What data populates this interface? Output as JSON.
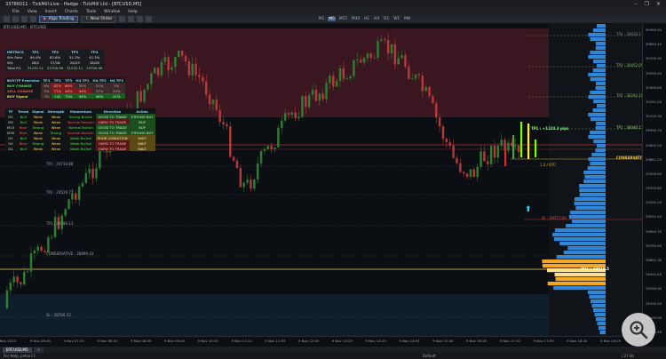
{
  "window": {
    "title": "33786011 - TickMill-Live - Hedge - TickMill Ltd - [BTCUSD,M5]",
    "controls": [
      "–",
      "❐",
      "✕"
    ]
  },
  "menu": [
    "File",
    "View",
    "Insert",
    "Charts",
    "Tools",
    "Window",
    "Help"
  ],
  "toolbar": {
    "algo_label": "Algo Trading",
    "new_order_label": "New Order",
    "timeframes": [
      "M1",
      "M5",
      "M15",
      "M30",
      "H1",
      "H4",
      "D1",
      "W1",
      "MN"
    ],
    "active_timeframe": "M5"
  },
  "chart": {
    "symbol_tag": "BTCUSD,M5 · BTCUSD",
    "metrics_table": {
      "headers": [
        "METRICS",
        "TP1",
        "TP2",
        "TP3",
        "TP4"
      ],
      "rows": [
        {
          "label": "Win Rate",
          "values": [
            "94.4%",
            "82.6%",
            "51.2%",
            "41.5%"
          ]
        },
        {
          "label": "W/L",
          "values": [
            "28/2",
            "17/16",
            "20/23",
            "18/26"
          ]
        },
        {
          "label": "Total P/L",
          "values": [
            "31232.11",
            "23700.96",
            "31232.11",
            "23700.96"
          ]
        }
      ]
    },
    "signal_table": {
      "headers": [
        "BUY/TP Precision",
        "TP1",
        "TP2",
        "TP3",
        "H4 TP1",
        "H4 TP2",
        "H4 TP3"
      ],
      "rows": [
        {
          "label": "BUY CHANGE",
          "values": [
            "6%",
            "82%",
            "68%",
            "30%",
            "21%",
            "5%"
          ]
        },
        {
          "label": "SELL CHANGE",
          "values": [
            "3%",
            "71%",
            "46%",
            "94%",
            "37%",
            "20%"
          ]
        },
        {
          "label": "BUY Signal",
          "values": [
            "3%",
            "+41",
            "72%",
            "94%",
            "46%",
            "41%"
          ]
        }
      ]
    },
    "trend_table": {
      "headers": [
        "TF",
        "Trend",
        "Signal",
        "Strength",
        "Momentum",
        "Direction",
        "Action"
      ],
      "rows": [
        {
          "tf": "M1",
          "trend": "Bull",
          "signal": "Weak",
          "strength": "Weak",
          "momentum": "Strong Bullish",
          "direction": "GOOD TO TRADE",
          "action": "STRONG BUY"
        },
        {
          "tf": "M5",
          "trend": "Bull",
          "signal": "Weak",
          "strength": "Weak",
          "momentum": "Normal Bearish",
          "direction": "HARD TO TRADE",
          "action": "BUY"
        },
        {
          "tf": "M15",
          "trend": "Bear",
          "signal": "Strong",
          "strength": "Weak",
          "momentum": "Normal Bullish",
          "direction": "GOOD TO TRADE",
          "action": "BUY"
        },
        {
          "tf": "M30",
          "trend": "Bear",
          "signal": "Weak",
          "strength": "Strong",
          "momentum": "Normal Bearish",
          "direction": "GOOD TO TRADE",
          "action": "STRONG BUY"
        },
        {
          "tf": "H1",
          "trend": "Bull",
          "signal": "Weak",
          "strength": "Weak",
          "momentum": "Weak Bullish",
          "direction": "POOR CONDITION",
          "action": "WAIT"
        },
        {
          "tf": "H4",
          "trend": "Bear",
          "signal": "Strong",
          "strength": "Weak",
          "momentum": "Weak Bullish",
          "direction": "HARD TO TRADE",
          "action": "WAIT"
        },
        {
          "tf": "D1",
          "trend": "Bull",
          "signal": "Weak",
          "strength": "Weak",
          "momentum": "Weak Bullish",
          "direction": "HARD TO TRADE",
          "action": "WAIT"
        }
      ]
    },
    "levels": {
      "tp4": "TP4 : 30836.11",
      "tp3": "TP3 : 30452.05",
      "tp2": "TP2 : 30242.18",
      "tp1": "TP1 : 30040.11",
      "tp1_pips": "TP1 : +1224.3 pips",
      "conservative": "CONSERVATIVE",
      "sl": "SL : 29771.00",
      "left_tp1": "TP1 : 29734.88",
      "left_tp2": "TP2 : 29526.77",
      "left_tp3": "TP1 : 29186.13",
      "left_conservative": "CONSERVATIVE : 28899.43",
      "left_sl": "SL : 28780.33",
      "entry_marker": "1.0 / BTC",
      "poc_label": "POC : 28919.5"
    },
    "price_axis": [
      "30990.55",
      "30850.10",
      "30700.20",
      "30550.45",
      "30400.80",
      "30251.05",
      "30100.30",
      "29950.70",
      "29801.00",
      "29651.25",
      "29500.60",
      "29350.80",
      "29201.20",
      "29051.40",
      "28900.70",
      "28750.90",
      "28601.30",
      "28451.60",
      "28300.90",
      "28150.20",
      "28000.00",
      "27850.30"
    ],
    "time_axis": [
      "9 Nov 2023",
      "9 Nov 06:40",
      "9 Nov 07:25",
      "9 Nov 08:10",
      "9 Nov 08:55",
      "9 Nov 09:40",
      "9 Nov 10:25",
      "9 Nov 11:10",
      "9 Nov 11:55",
      "9 Nov 12:40",
      "9 Nov 13:25",
      "9 Nov 14:10",
      "9 Nov 14:55",
      "9 Nov 15:40",
      "9 Nov 16:25",
      "9 Nov 17:10",
      "9 Nov 17:55",
      "9 Nov 18:40",
      "9 Nov 19:25"
    ],
    "colors": {
      "bull": "#2e7d32",
      "bear": "#b23a3a",
      "upper_zone": "#3a1620",
      "lower_zone": "#0f1e2b",
      "profile": "#2f86d6",
      "poc": "#f5a623",
      "yellow_line": "#e8d15a",
      "red_line": "#c03030"
    }
  },
  "tabs": [
    "BTCUSD,M5",
    "+"
  ],
  "status": {
    "left": "For Help, press F1",
    "mid": "Default",
    "right": "/ 27 kb"
  }
}
